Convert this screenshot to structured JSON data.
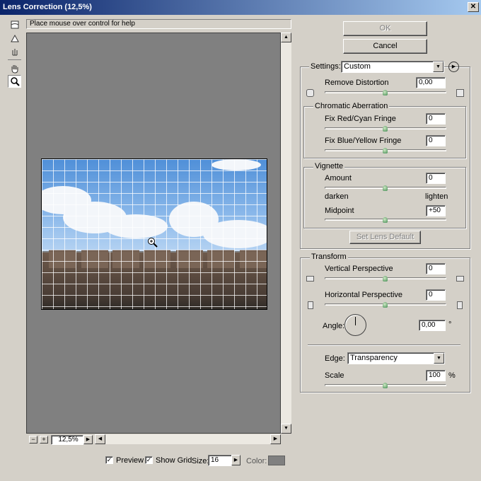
{
  "window": {
    "title": "Lens Correction (12,5%)",
    "close_glyph": "✕"
  },
  "help_text": "Place mouse over control for help",
  "zoom": {
    "minus": "−",
    "plus": "+",
    "value": "12,5%"
  },
  "buttons": {
    "ok": "OK",
    "cancel": "Cancel",
    "set_lens_default": "Set Lens Default"
  },
  "settings": {
    "label": "Settings:",
    "value": "Custom"
  },
  "remove_distortion": {
    "label": "Remove Distortion",
    "value": "0,00"
  },
  "chromatic": {
    "title": "Chromatic Aberration",
    "red_cyan": {
      "label": "Fix Red/Cyan Fringe",
      "value": "0"
    },
    "blue_yellow": {
      "label": "Fix Blue/Yellow Fringe",
      "value": "0"
    }
  },
  "vignette": {
    "title": "Vignette",
    "amount": {
      "label": "Amount",
      "value": "0"
    },
    "darken": "darken",
    "lighten": "lighten",
    "midpoint": {
      "label": "Midpoint",
      "value": "+50"
    }
  },
  "transform": {
    "title": "Transform",
    "vertical": {
      "label": "Vertical Perspective",
      "value": "0"
    },
    "horizontal": {
      "label": "Horizontal Perspective",
      "value": "0"
    },
    "angle": {
      "label": "Angle:",
      "value": "0,00",
      "unit": "°"
    },
    "edge": {
      "label": "Edge:",
      "value": "Transparency"
    },
    "scale": {
      "label": "Scale",
      "value": "100",
      "unit": "%"
    }
  },
  "bottom": {
    "preview": "Preview",
    "show_grid": "Show Grid",
    "size_label": "Size:",
    "size_value": "16",
    "color_label": "Color:",
    "check_glyph": "✓"
  },
  "slider_levels": {
    "remove_distortion": 0.5,
    "red_cyan": 0.5,
    "blue_yellow": 0.5,
    "amount": 0.5,
    "midpoint": 0.5,
    "vertical": 0.5,
    "horizontal": 0.5,
    "scale": 0.5
  },
  "colors": {
    "title_start": "#0a246a",
    "title_end": "#a6caf0",
    "canvas": "#808080",
    "grid_color": "#808080"
  }
}
